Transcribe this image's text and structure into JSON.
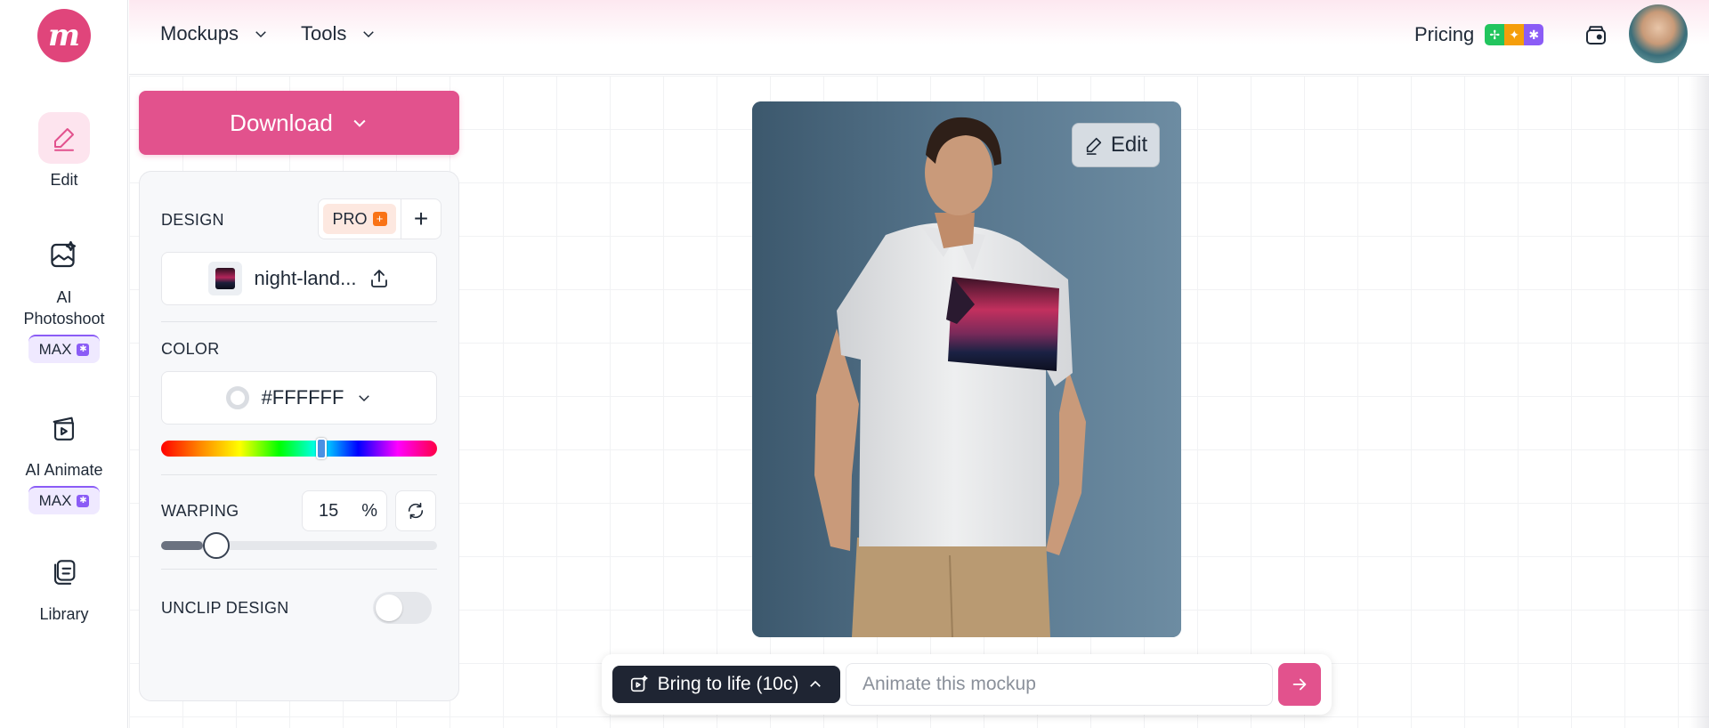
{
  "nav": {
    "mockups_label": "Mockups",
    "tools_label": "Tools",
    "pricing_label": "Pricing"
  },
  "sidebar": {
    "items": [
      {
        "label": "Edit",
        "icon": "pencil-icon"
      },
      {
        "label": "AI Photoshoot",
        "icon": "photoshoot-icon",
        "badge": "MAX"
      },
      {
        "label": "AI Animate",
        "icon": "animate-icon",
        "badge": "MAX"
      },
      {
        "label": "Library",
        "icon": "library-icon"
      }
    ]
  },
  "panel": {
    "download_label": "Download",
    "design_label": "DESIGN",
    "pro_label": "PRO",
    "file_name": "night-land...",
    "color_label": "COLOR",
    "color_value": "#FFFFFF",
    "hue_position": 0.58,
    "warping_label": "WARPING",
    "warping_value": "15",
    "warping_unit": "%",
    "warping_slider": 0.15,
    "unclip_label": "UNCLIP DESIGN",
    "unclip_enabled": false
  },
  "canvas": {
    "edit_label": "Edit"
  },
  "bottom": {
    "bring_to_life_label": "Bring to life (10c)",
    "animate_placeholder": "Animate this mockup"
  },
  "colors": {
    "brand_pink": "#e2528d",
    "logo_pink": "#e0457b",
    "max_purple": "#8b5cf6",
    "dark_button": "#1f2533"
  }
}
